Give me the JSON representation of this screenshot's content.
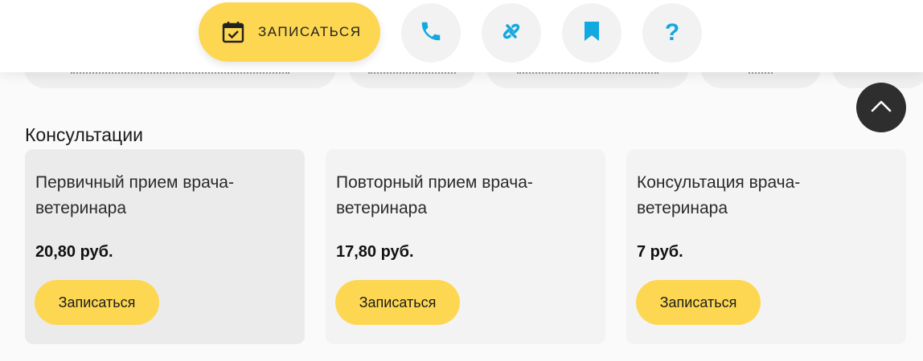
{
  "toolbar": {
    "book_label": "ЗАПИСАТЬСЯ",
    "icons": {
      "book": "calendar-check-icon",
      "phone": "phone-icon",
      "share": "link-icon",
      "bookmark": "bookmark-icon",
      "help": "question-icon"
    }
  },
  "section": {
    "title": "Консультации"
  },
  "cards": [
    {
      "title": "Первичный прием врача-ветеринара",
      "price": "20,80 руб.",
      "button": "Записаться"
    },
    {
      "title": "Повторный прием врача-ветеринара",
      "price": "17,80 руб.",
      "button": "Записаться"
    },
    {
      "title": "Консультация врача-ветеринара",
      "price": "7 руб.",
      "button": "Записаться"
    }
  ],
  "colors": {
    "accent": "#fdd751",
    "icon": "#12a8e0",
    "dark": "#2e2e2e"
  }
}
